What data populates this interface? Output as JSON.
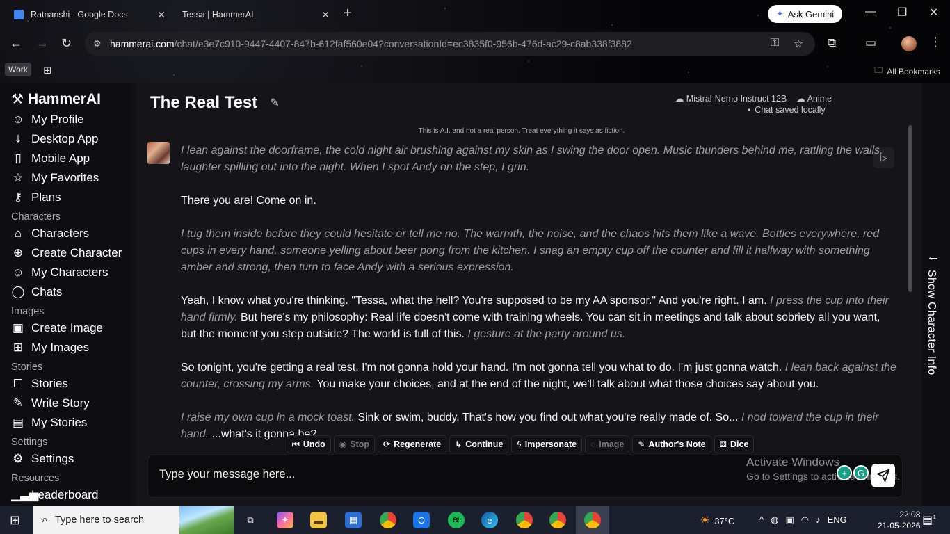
{
  "browser": {
    "tabs": [
      {
        "title": "Ratnanshi - Google Docs",
        "color": "#4285f4"
      },
      {
        "title": "Tessa | HammerAI",
        "color": "#111111"
      }
    ],
    "ask_gemini": "Ask Gemini",
    "url_domain": "hammerai.com",
    "url_path": "/chat/e3e7c910-9447-4407-847b-612faf560e04?conversationId=ec3835f0-956b-476d-ac29-c8ab338f3882",
    "profile_label": "Work",
    "bookmarks_label": "All Bookmarks"
  },
  "sidebar": {
    "brand": "HammerAI",
    "top_items": [
      {
        "label": "My Profile",
        "icon": "user-icon"
      },
      {
        "label": "Desktop App",
        "icon": "download-icon"
      },
      {
        "label": "Mobile App",
        "icon": "phone-icon"
      },
      {
        "label": "My Favorites",
        "icon": "star-icon"
      },
      {
        "label": "Plans",
        "icon": "key-icon"
      }
    ],
    "sections": [
      {
        "title": "Characters",
        "items": [
          {
            "label": "Characters",
            "icon": "home-icon"
          },
          {
            "label": "Create Character",
            "icon": "plus-circle-icon"
          },
          {
            "label": "My Characters",
            "icon": "user-icon"
          },
          {
            "label": "Chats",
            "icon": "chat-bubble-icon"
          }
        ]
      },
      {
        "title": "Images",
        "items": [
          {
            "label": "Create Image",
            "icon": "image-icon"
          },
          {
            "label": "My Images",
            "icon": "grid-icon"
          }
        ]
      },
      {
        "title": "Stories",
        "items": [
          {
            "label": "Stories",
            "icon": "book-open-icon"
          },
          {
            "label": "Write Story",
            "icon": "pen-icon"
          },
          {
            "label": "My Stories",
            "icon": "book-icon"
          }
        ]
      },
      {
        "title": "Settings",
        "items": [
          {
            "label": "Settings",
            "icon": "gear-icon"
          }
        ]
      },
      {
        "title": "Resources",
        "items": [
          {
            "label": "Leaderboard",
            "icon": "bar-chart-icon"
          }
        ]
      }
    ]
  },
  "chat": {
    "title": "The Real Test",
    "model": "Mistral-Nemo Instruct 12B",
    "style": "Anime",
    "saved_status": "Chat saved locally",
    "disclaimer": "This is A.I. and not a real person. Treat everything it says as fiction.",
    "message": {
      "p1": "I lean against the doorframe, the cold night air brushing against my skin as I swing the door open. Music thunders behind me, rattling the walls, laughter spilling out into the night. When I spot Andy on the step, I grin.",
      "p2": "There you are! Come on in.",
      "p3": "I tug them inside before they could hesitate or tell me no. The warmth, the noise, and the chaos hits them like a wave. Bottles everywhere, red cups in every hand, someone yelling about beer pong from the kitchen. I snag an empty cup off the counter and fill it halfway with something amber and strong, then turn to face Andy with a serious expression.",
      "p4a": "Yeah, I know what you're thinking. \"Tessa, what the hell? You're supposed to be my AA sponsor.\" And you're right. I am.",
      "p4b": "I press the cup into their hand firmly.",
      "p4c": "But here's my philosophy: Real life doesn't come with training wheels. You can sit in meetings and talk about sobriety all you want, but the moment you step outside? The world is full of this.",
      "p4d": "I gesture at the party around us.",
      "p5a": "So tonight, you're getting a real test. I'm not gonna hold your hand. I'm not gonna tell you what to do. I'm just gonna watch.",
      "p5b": "I lean back against the counter, crossing my arms.",
      "p5c": "You make your choices, and at the end of the night, we'll talk about what those choices say about you.",
      "p6a": "I raise my own cup in a mock toast.",
      "p6b": "Sink or swim, buddy. That's how you find out what you're really made of. So...",
      "p6c": "I nod toward the cup in their hand.",
      "p6d": "...what's it gonna be?"
    },
    "actions": [
      {
        "label": "Undo",
        "icon": "skip-back-icon",
        "enabled": true
      },
      {
        "label": "Stop",
        "icon": "stop-circle-icon",
        "enabled": false
      },
      {
        "label": "Regenerate",
        "icon": "refresh-icon",
        "enabled": true
      },
      {
        "label": "Continue",
        "icon": "corner-arrow-icon",
        "enabled": true
      },
      {
        "label": "Impersonate",
        "icon": "bolt-icon",
        "enabled": true
      },
      {
        "label": "Image",
        "icon": "loading-icon",
        "enabled": false
      },
      {
        "label": "Author's Note",
        "icon": "pencil-icon",
        "enabled": true
      },
      {
        "label": "Dice",
        "icon": "dice-icon",
        "enabled": true
      }
    ],
    "input_placeholder": "Type your message here...",
    "show_character_info": "Show Character Info"
  },
  "overlay": {
    "activate_title": "Activate Windows",
    "activate_sub": "Go to Settings to activate Windows."
  },
  "taskbar": {
    "search_placeholder": "Type here to search",
    "temperature": "37°C",
    "language": "ENG",
    "time": "22:08",
    "date": "21-05-2026",
    "notifications": "1"
  }
}
